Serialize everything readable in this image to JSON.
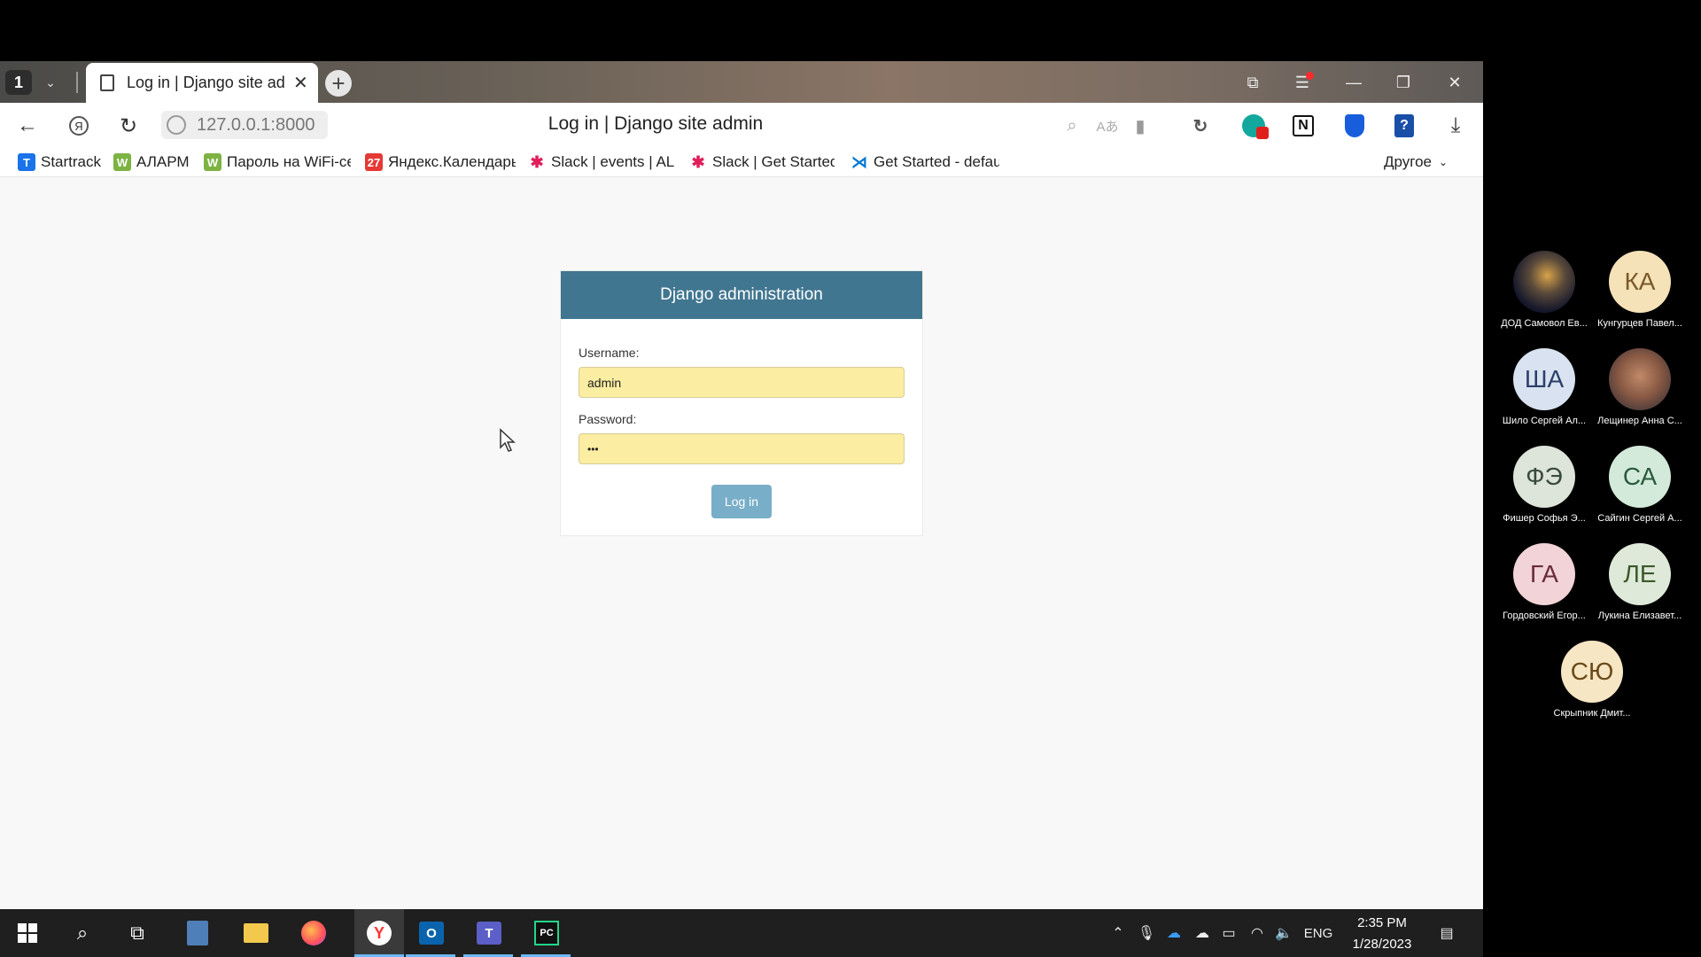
{
  "browser": {
    "tab_count": "1",
    "active_tab_title": "Log in | Django site adm",
    "url": "127.0.0.1:8000",
    "page_title": "Log in | Django site admin",
    "bookmarks": [
      {
        "label": "Startrack",
        "icon": "startrack-icon",
        "color": "#1a73e8"
      },
      {
        "label": "АЛАРМ",
        "icon": "wiki-icon",
        "color": "#7cb342"
      },
      {
        "label": "Пароль на WiFi-се",
        "icon": "wiki-icon",
        "color": "#7cb342"
      },
      {
        "label": "Яндекс.Календарь",
        "icon": "calendar-icon",
        "color": "#e53935"
      },
      {
        "label": "Slack | events | ALL",
        "icon": "slack-icon",
        "color": "#4a154b"
      },
      {
        "label": "Slack | Get Started",
        "icon": "slack-icon",
        "color": "#4a154b"
      },
      {
        "label": "Get Started - defau",
        "icon": "vscode-icon",
        "color": "#0078d4"
      }
    ],
    "other_bookmarks": "Другое"
  },
  "login": {
    "header": "Django administration",
    "username_label": "Username:",
    "username_value": "admin",
    "password_label": "Password:",
    "password_value": "•••",
    "submit_label": "Log in"
  },
  "taskbar": {
    "language": "ENG",
    "time": "2:35 PM",
    "date": "1/28/2023"
  },
  "participants": [
    {
      "initials": "",
      "name": "ДОД Самовол Ев...",
      "color": "#3a3a55",
      "photo": true
    },
    {
      "initials": "КА",
      "name": "Кунгурцев Павел...",
      "color": "#f6e2b8"
    },
    {
      "initials": "ША",
      "name": "Шило Сергей Ал...",
      "color": "#d9e2f0"
    },
    {
      "initials": "",
      "name": "Лещинер Анна С...",
      "color": "#9a6d52",
      "photo": true
    },
    {
      "initials": "ФЭ",
      "name": "Фишер Софья Э...",
      "color": "#dde4da"
    },
    {
      "initials": "СА",
      "name": "Сайгин Сергей А...",
      "color": "#d3eadb"
    },
    {
      "initials": "ГА",
      "name": "Гордовский Егор...",
      "color": "#f1d3d8"
    },
    {
      "initials": "ЛЕ",
      "name": "Лукина Елизавет...",
      "color": "#dfe9d9"
    },
    {
      "initials": "СЮ",
      "name": "Скрыпник Дмит...",
      "color": "#f7e6c4"
    }
  ]
}
